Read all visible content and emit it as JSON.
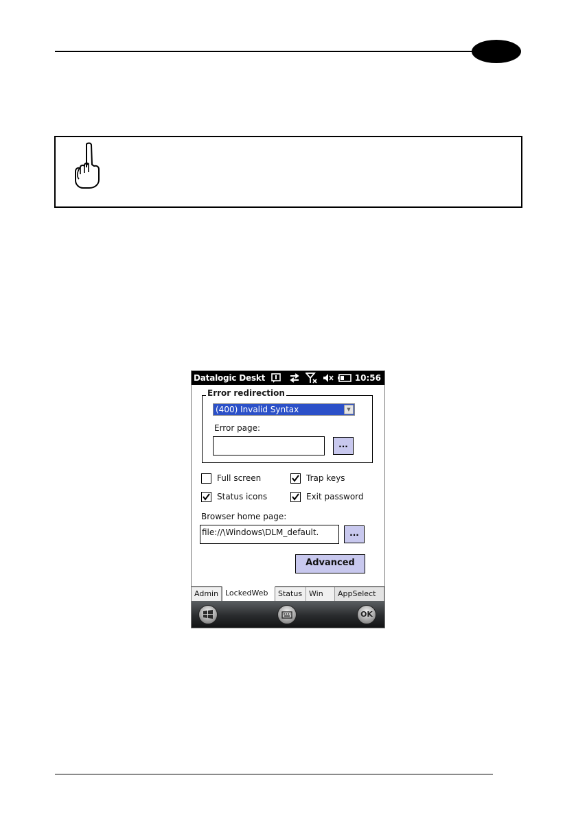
{
  "device": {
    "statusbar": {
      "app_title": "Datalogic Deskt",
      "time": "10:56",
      "icons": [
        "notification-icon",
        "connectivity-arrows-icon",
        "no-signal-icon",
        "speaker-muted-icon",
        "battery-icon"
      ]
    },
    "error_redirection": {
      "group_title": "Error redirection",
      "selected_error": "(400) Invalid Syntax",
      "error_page_label": "Error page:",
      "error_page_value": "",
      "browse_label": "..."
    },
    "options": {
      "full_screen": {
        "label": "Full screen",
        "checked": false
      },
      "trap_keys": {
        "label": "Trap keys",
        "checked": true
      },
      "status_icons": {
        "label": "Status icons",
        "checked": true
      },
      "exit_password": {
        "label": "Exit password",
        "checked": true
      }
    },
    "home_page": {
      "label": "Browser home page:",
      "value": "file://\\Windows\\DLM_default.",
      "browse_label": "..."
    },
    "advanced_label": "Advanced",
    "tabs": [
      {
        "label": "Admin",
        "active": false
      },
      {
        "label": "LockedWeb",
        "active": true
      },
      {
        "label": "Status",
        "active": false
      },
      {
        "label": "Win",
        "active": false
      },
      {
        "label": "AppSelect",
        "active": false
      }
    ],
    "softkeys": {
      "start": "windows-start-icon",
      "keyboard": "keyboard-icon",
      "ok_label": "OK"
    }
  }
}
